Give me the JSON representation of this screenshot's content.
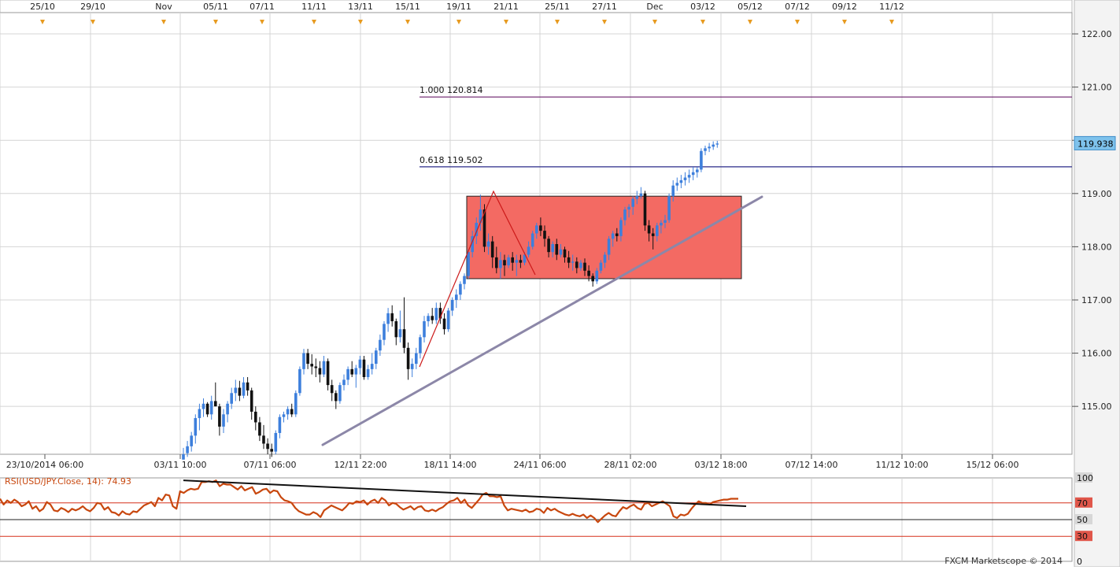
{
  "app": {
    "watermark": "FXCM Marketscope © 2014",
    "colors": {
      "background": "#ffffff",
      "grid": "#d4d4d4",
      "bull": "#3d7fdc",
      "bear": "#111111",
      "rectangle_fill": "#f36a63",
      "fib_1000": "#6a1f6a",
      "fib_0618": "#2a2a8a",
      "trendline": "#8c87a8",
      "zigzag": "#cc1a1a",
      "rsi_line": "#c8470e",
      "rsi_trend": "#111111",
      "level_line": "#d6301a",
      "marker": "#e79a1f",
      "current_price_bg": "#7ec2ec"
    }
  },
  "chart_data": [
    {
      "type": "candlestick",
      "symbol": "USD/JPY",
      "ylim": [
        114.1,
        122.4
      ],
      "yticks": [
        115.0,
        116.0,
        117.0,
        118.0,
        119.0,
        120.0,
        121.0,
        122.0
      ],
      "ytick_labels": [
        "115.00",
        "116.00",
        "117.00",
        "118.00",
        "119.00",
        "120.00",
        "121.00",
        "122.00"
      ],
      "top_axis_labels": [
        "25/10",
        "29/10",
        "Nov",
        "05/11",
        "07/11",
        "11/11",
        "13/11",
        "15/11",
        "19/11",
        "21/11",
        "25/11",
        "27/11",
        "Dec",
        "03/12",
        "05/12",
        "07/12",
        "09/12",
        "11/12"
      ],
      "bottom_axis_labels": [
        "23/10/2014 06:00",
        "03/11 10:00",
        "07/11 06:00",
        "12/11 22:00",
        "18/11 14:00",
        "24/11 06:00",
        "28/11 02:00",
        "03/12 18:00",
        "07/12 14:00",
        "11/12 10:00",
        "15/12 06:00"
      ],
      "current_price": 119.938,
      "current_price_label": "119.938",
      "fib_levels": [
        {
          "ratio": "1.000",
          "value": 120.814,
          "label": "1.000 120.814"
        },
        {
          "ratio": "0.618",
          "value": 119.502,
          "label": "0.618 119.502"
        }
      ],
      "rectangle": {
        "y_top": 118.95,
        "y_bottom": 117.4
      },
      "candles": [
        {
          "o": 114.0,
          "h": 114.22,
          "l": 114.0,
          "c": 114.1
        },
        {
          "o": 114.12,
          "h": 114.35,
          "l": 114.05,
          "c": 114.25
        },
        {
          "o": 114.25,
          "h": 114.52,
          "l": 114.15,
          "c": 114.45
        },
        {
          "o": 114.45,
          "h": 114.85,
          "l": 114.3,
          "c": 114.78
        },
        {
          "o": 114.78,
          "h": 115.05,
          "l": 114.55,
          "c": 114.95
        },
        {
          "o": 114.95,
          "h": 115.15,
          "l": 114.8,
          "c": 115.05
        },
        {
          "o": 115.05,
          "h": 115.08,
          "l": 114.8,
          "c": 114.85
        },
        {
          "o": 114.85,
          "h": 115.2,
          "l": 114.75,
          "c": 115.1
        },
        {
          "o": 115.1,
          "h": 115.45,
          "l": 115.0,
          "c": 115.0
        },
        {
          "o": 115.0,
          "h": 115.05,
          "l": 114.45,
          "c": 114.62
        },
        {
          "o": 114.62,
          "h": 114.95,
          "l": 114.5,
          "c": 114.85
        },
        {
          "o": 114.85,
          "h": 115.1,
          "l": 114.7,
          "c": 115.05
        },
        {
          "o": 115.05,
          "h": 115.35,
          "l": 114.95,
          "c": 115.25
        },
        {
          "o": 115.25,
          "h": 115.5,
          "l": 115.1,
          "c": 115.35
        },
        {
          "o": 115.35,
          "h": 115.48,
          "l": 115.1,
          "c": 115.2
        },
        {
          "o": 115.2,
          "h": 115.55,
          "l": 115.15,
          "c": 115.45
        },
        {
          "o": 115.45,
          "h": 115.55,
          "l": 115.2,
          "c": 115.3
        },
        {
          "o": 115.3,
          "h": 115.35,
          "l": 114.75,
          "c": 114.9
        },
        {
          "o": 114.9,
          "h": 115.0,
          "l": 114.55,
          "c": 114.7
        },
        {
          "o": 114.7,
          "h": 114.8,
          "l": 114.35,
          "c": 114.45
        },
        {
          "o": 114.45,
          "h": 114.65,
          "l": 114.2,
          "c": 114.3
        },
        {
          "o": 114.3,
          "h": 114.4,
          "l": 114.1,
          "c": 114.2
        },
        {
          "o": 114.2,
          "h": 114.3,
          "l": 114.05,
          "c": 114.15
        },
        {
          "o": 114.15,
          "h": 114.55,
          "l": 114.1,
          "c": 114.5
        },
        {
          "o": 114.5,
          "h": 114.85,
          "l": 114.4,
          "c": 114.8
        },
        {
          "o": 114.8,
          "h": 114.9,
          "l": 114.7,
          "c": 114.85
        },
        {
          "o": 114.85,
          "h": 115.0,
          "l": 114.75,
          "c": 114.95
        },
        {
          "o": 114.95,
          "h": 115.05,
          "l": 114.8,
          "c": 114.85
        },
        {
          "o": 114.85,
          "h": 115.3,
          "l": 114.8,
          "c": 115.25
        },
        {
          "o": 115.25,
          "h": 115.75,
          "l": 115.2,
          "c": 115.7
        },
        {
          "o": 115.7,
          "h": 116.08,
          "l": 115.6,
          "c": 116.0
        },
        {
          "o": 116.0,
          "h": 116.08,
          "l": 115.7,
          "c": 115.8
        },
        {
          "o": 115.8,
          "h": 115.98,
          "l": 115.6,
          "c": 115.75
        },
        {
          "o": 115.75,
          "h": 115.9,
          "l": 115.55,
          "c": 115.72
        },
        {
          "o": 115.72,
          "h": 115.85,
          "l": 115.45,
          "c": 115.6
        },
        {
          "o": 115.6,
          "h": 115.95,
          "l": 115.55,
          "c": 115.85
        },
        {
          "o": 115.85,
          "h": 115.9,
          "l": 115.3,
          "c": 115.4
        },
        {
          "o": 115.4,
          "h": 115.5,
          "l": 115.1,
          "c": 115.25
        },
        {
          "o": 115.25,
          "h": 115.3,
          "l": 114.95,
          "c": 115.1
        },
        {
          "o": 115.1,
          "h": 115.45,
          "l": 115.05,
          "c": 115.4
        },
        {
          "o": 115.4,
          "h": 115.6,
          "l": 115.3,
          "c": 115.5
        },
        {
          "o": 115.5,
          "h": 115.75,
          "l": 115.4,
          "c": 115.7
        },
        {
          "o": 115.7,
          "h": 115.85,
          "l": 115.55,
          "c": 115.6
        },
        {
          "o": 115.6,
          "h": 115.78,
          "l": 115.35,
          "c": 115.72
        },
        {
          "o": 115.72,
          "h": 115.95,
          "l": 115.6,
          "c": 115.88
        },
        {
          "o": 115.88,
          "h": 115.95,
          "l": 115.5,
          "c": 115.55
        },
        {
          "o": 115.55,
          "h": 115.78,
          "l": 115.5,
          "c": 115.7
        },
        {
          "o": 115.7,
          "h": 116.0,
          "l": 115.6,
          "c": 115.8
        },
        {
          "o": 115.8,
          "h": 116.1,
          "l": 115.7,
          "c": 116.05
        },
        {
          "o": 116.05,
          "h": 116.35,
          "l": 115.95,
          "c": 116.25
        },
        {
          "o": 116.25,
          "h": 116.6,
          "l": 116.15,
          "c": 116.55
        },
        {
          "o": 116.55,
          "h": 116.85,
          "l": 116.4,
          "c": 116.75
        },
        {
          "o": 116.75,
          "h": 116.9,
          "l": 116.5,
          "c": 116.6
        },
        {
          "o": 116.6,
          "h": 116.65,
          "l": 116.15,
          "c": 116.3
        },
        {
          "o": 116.3,
          "h": 116.8,
          "l": 116.2,
          "c": 116.45
        },
        {
          "o": 116.45,
          "h": 117.05,
          "l": 116.0,
          "c": 116.1
        },
        {
          "o": 116.1,
          "h": 116.2,
          "l": 115.5,
          "c": 115.7
        },
        {
          "o": 115.7,
          "h": 115.9,
          "l": 115.55,
          "c": 115.8
        },
        {
          "o": 115.8,
          "h": 116.1,
          "l": 115.7,
          "c": 116.0
        },
        {
          "o": 116.0,
          "h": 116.35,
          "l": 115.9,
          "c": 116.3
        },
        {
          "o": 116.3,
          "h": 116.7,
          "l": 116.2,
          "c": 116.6
        },
        {
          "o": 116.6,
          "h": 116.75,
          "l": 116.5,
          "c": 116.7
        },
        {
          "o": 116.7,
          "h": 116.85,
          "l": 116.55,
          "c": 116.62
        },
        {
          "o": 116.62,
          "h": 116.95,
          "l": 116.55,
          "c": 116.85
        },
        {
          "o": 116.85,
          "h": 116.95,
          "l": 116.55,
          "c": 116.65
        },
        {
          "o": 116.65,
          "h": 116.75,
          "l": 116.35,
          "c": 116.45
        },
        {
          "o": 116.45,
          "h": 116.85,
          "l": 116.4,
          "c": 116.8
        },
        {
          "o": 116.8,
          "h": 117.05,
          "l": 116.7,
          "c": 117.0
        },
        {
          "o": 117.0,
          "h": 117.2,
          "l": 116.85,
          "c": 117.1
        },
        {
          "o": 117.1,
          "h": 117.35,
          "l": 117.0,
          "c": 117.3
        },
        {
          "o": 117.3,
          "h": 117.5,
          "l": 117.2,
          "c": 117.45
        },
        {
          "o": 117.45,
          "h": 117.95,
          "l": 117.4,
          "c": 117.9
        },
        {
          "o": 117.9,
          "h": 118.3,
          "l": 117.8,
          "c": 118.2
        },
        {
          "o": 118.2,
          "h": 118.55,
          "l": 118.05,
          "c": 118.45
        },
        {
          "o": 118.45,
          "h": 118.98,
          "l": 118.3,
          "c": 118.7
        },
        {
          "o": 118.7,
          "h": 118.8,
          "l": 117.9,
          "c": 118.0
        },
        {
          "o": 118.0,
          "h": 118.25,
          "l": 117.85,
          "c": 118.1
        },
        {
          "o": 118.1,
          "h": 118.2,
          "l": 117.6,
          "c": 117.8
        },
        {
          "o": 117.8,
          "h": 118.0,
          "l": 117.5,
          "c": 117.6
        },
        {
          "o": 117.6,
          "h": 117.9,
          "l": 117.4,
          "c": 117.75
        },
        {
          "o": 117.75,
          "h": 117.85,
          "l": 117.45,
          "c": 117.65
        },
        {
          "o": 117.65,
          "h": 117.85,
          "l": 117.6,
          "c": 117.8
        },
        {
          "o": 117.8,
          "h": 117.9,
          "l": 117.55,
          "c": 117.7
        },
        {
          "o": 117.7,
          "h": 117.85,
          "l": 117.45,
          "c": 117.75
        },
        {
          "o": 117.75,
          "h": 117.85,
          "l": 117.6,
          "c": 117.7
        },
        {
          "o": 117.7,
          "h": 117.9,
          "l": 117.65,
          "c": 117.85
        },
        {
          "o": 117.85,
          "h": 118.1,
          "l": 117.8,
          "c": 118.0
        },
        {
          "o": 118.0,
          "h": 118.3,
          "l": 117.95,
          "c": 118.25
        },
        {
          "o": 118.25,
          "h": 118.45,
          "l": 118.15,
          "c": 118.4
        },
        {
          "o": 118.4,
          "h": 118.55,
          "l": 118.2,
          "c": 118.3
        },
        {
          "o": 118.3,
          "h": 118.4,
          "l": 118.0,
          "c": 118.15
        },
        {
          "o": 118.15,
          "h": 118.2,
          "l": 117.8,
          "c": 117.9
        },
        {
          "o": 117.9,
          "h": 118.1,
          "l": 117.8,
          "c": 118.05
        },
        {
          "o": 118.05,
          "h": 118.15,
          "l": 117.75,
          "c": 117.85
        },
        {
          "o": 117.85,
          "h": 118.05,
          "l": 117.8,
          "c": 117.95
        },
        {
          "o": 117.95,
          "h": 118.0,
          "l": 117.7,
          "c": 117.8
        },
        {
          "o": 117.8,
          "h": 117.92,
          "l": 117.6,
          "c": 117.7
        },
        {
          "o": 117.7,
          "h": 117.85,
          "l": 117.55,
          "c": 117.72
        },
        {
          "o": 117.72,
          "h": 117.8,
          "l": 117.5,
          "c": 117.6
        },
        {
          "o": 117.6,
          "h": 117.75,
          "l": 117.55,
          "c": 117.7
        },
        {
          "o": 117.7,
          "h": 117.78,
          "l": 117.45,
          "c": 117.55
        },
        {
          "o": 117.55,
          "h": 117.65,
          "l": 117.35,
          "c": 117.45
        },
        {
          "o": 117.45,
          "h": 117.5,
          "l": 117.25,
          "c": 117.35
        },
        {
          "o": 117.35,
          "h": 117.6,
          "l": 117.3,
          "c": 117.55
        },
        {
          "o": 117.55,
          "h": 117.75,
          "l": 117.5,
          "c": 117.7
        },
        {
          "o": 117.7,
          "h": 117.9,
          "l": 117.6,
          "c": 117.85
        },
        {
          "o": 117.85,
          "h": 118.2,
          "l": 117.75,
          "c": 118.15
        },
        {
          "o": 118.15,
          "h": 118.3,
          "l": 118.0,
          "c": 118.25
        },
        {
          "o": 118.25,
          "h": 118.35,
          "l": 118.1,
          "c": 118.2
        },
        {
          "o": 118.2,
          "h": 118.55,
          "l": 118.1,
          "c": 118.5
        },
        {
          "o": 118.5,
          "h": 118.75,
          "l": 118.4,
          "c": 118.7
        },
        {
          "o": 118.7,
          "h": 118.8,
          "l": 118.55,
          "c": 118.75
        },
        {
          "o": 118.75,
          "h": 118.95,
          "l": 118.6,
          "c": 118.9
        },
        {
          "o": 118.9,
          "h": 119.05,
          "l": 118.8,
          "c": 118.95
        },
        {
          "o": 118.95,
          "h": 119.12,
          "l": 118.9,
          "c": 119.0
        },
        {
          "o": 119.0,
          "h": 119.05,
          "l": 118.3,
          "c": 118.4
        },
        {
          "o": 118.4,
          "h": 118.5,
          "l": 118.1,
          "c": 118.25
        },
        {
          "o": 118.25,
          "h": 118.35,
          "l": 117.95,
          "c": 118.2
        },
        {
          "o": 118.2,
          "h": 118.45,
          "l": 118.1,
          "c": 118.4
        },
        {
          "o": 118.4,
          "h": 118.5,
          "l": 118.25,
          "c": 118.45
        },
        {
          "o": 118.45,
          "h": 118.6,
          "l": 118.35,
          "c": 118.5
        },
        {
          "o": 118.5,
          "h": 119.0,
          "l": 118.45,
          "c": 118.95
        },
        {
          "o": 118.95,
          "h": 119.25,
          "l": 118.85,
          "c": 119.15
        },
        {
          "o": 119.15,
          "h": 119.3,
          "l": 119.05,
          "c": 119.2
        },
        {
          "o": 119.2,
          "h": 119.35,
          "l": 119.1,
          "c": 119.25
        },
        {
          "o": 119.25,
          "h": 119.4,
          "l": 119.15,
          "c": 119.3
        },
        {
          "o": 119.3,
          "h": 119.45,
          "l": 119.2,
          "c": 119.35
        },
        {
          "o": 119.35,
          "h": 119.5,
          "l": 119.25,
          "c": 119.4
        },
        {
          "o": 119.4,
          "h": 119.5,
          "l": 119.3,
          "c": 119.45
        },
        {
          "o": 119.45,
          "h": 119.85,
          "l": 119.4,
          "c": 119.8
        },
        {
          "o": 119.8,
          "h": 119.9,
          "l": 119.72,
          "c": 119.85
        },
        {
          "o": 119.85,
          "h": 119.95,
          "l": 119.78,
          "c": 119.88
        },
        {
          "o": 119.88,
          "h": 119.98,
          "l": 119.82,
          "c": 119.92
        },
        {
          "o": 119.92,
          "h": 119.99,
          "l": 119.86,
          "c": 119.94
        }
      ]
    },
    {
      "type": "line",
      "title": "RSI(USD/JPY.Close, 14): 74.93",
      "ylim": [
        0,
        100
      ],
      "levels": [
        {
          "value": 100,
          "label": "100"
        },
        {
          "value": 70,
          "label": "70"
        },
        {
          "value": 50,
          "label": "50"
        },
        {
          "value": 30,
          "label": "30"
        },
        {
          "value": 0,
          "label": "0"
        }
      ],
      "rsi": [
        75,
        68,
        73,
        70,
        74,
        71,
        66,
        68,
        72,
        63,
        66,
        60,
        63,
        71,
        68,
        61,
        60,
        64,
        62,
        59,
        63,
        61,
        63,
        66,
        62,
        60,
        64,
        70,
        69,
        62,
        65,
        59,
        58,
        55,
        60,
        57,
        56,
        60,
        59,
        63,
        67,
        69,
        71,
        66,
        76,
        73,
        80,
        79,
        66,
        63,
        84,
        82,
        85,
        87,
        86,
        87,
        95,
        95,
        96,
        95,
        97,
        90,
        93,
        92,
        92,
        89,
        86,
        90,
        85,
        87,
        89,
        81,
        83,
        86,
        87,
        82,
        85,
        84,
        77,
        73,
        72,
        70,
        64,
        60,
        58,
        56,
        56,
        59,
        57,
        53,
        61,
        64,
        67,
        65,
        63,
        61,
        65,
        70,
        69,
        72,
        71,
        73,
        68,
        72,
        74,
        70,
        76,
        73,
        67,
        70,
        69,
        65,
        62,
        64,
        66,
        62,
        65,
        66,
        61,
        60,
        62,
        60,
        63,
        65,
        69,
        72,
        73,
        76,
        70,
        74,
        67,
        64,
        69,
        74,
        80,
        82,
        78,
        78,
        77,
        78,
        67,
        61,
        63,
        62,
        61,
        60,
        62,
        59,
        60,
        63,
        62,
        58,
        64,
        61,
        63,
        60,
        58,
        56,
        55,
        57,
        55,
        54,
        56,
        52,
        55,
        52,
        47,
        51,
        55,
        58,
        55,
        54,
        60,
        65,
        63,
        66,
        68,
        64,
        62,
        69,
        70,
        66,
        68,
        70,
        72,
        69,
        66,
        54,
        52,
        56,
        55,
        57,
        63,
        68,
        72,
        70,
        70,
        68,
        71,
        72,
        73,
        74,
        74,
        75,
        75,
        75
      ]
    }
  ]
}
